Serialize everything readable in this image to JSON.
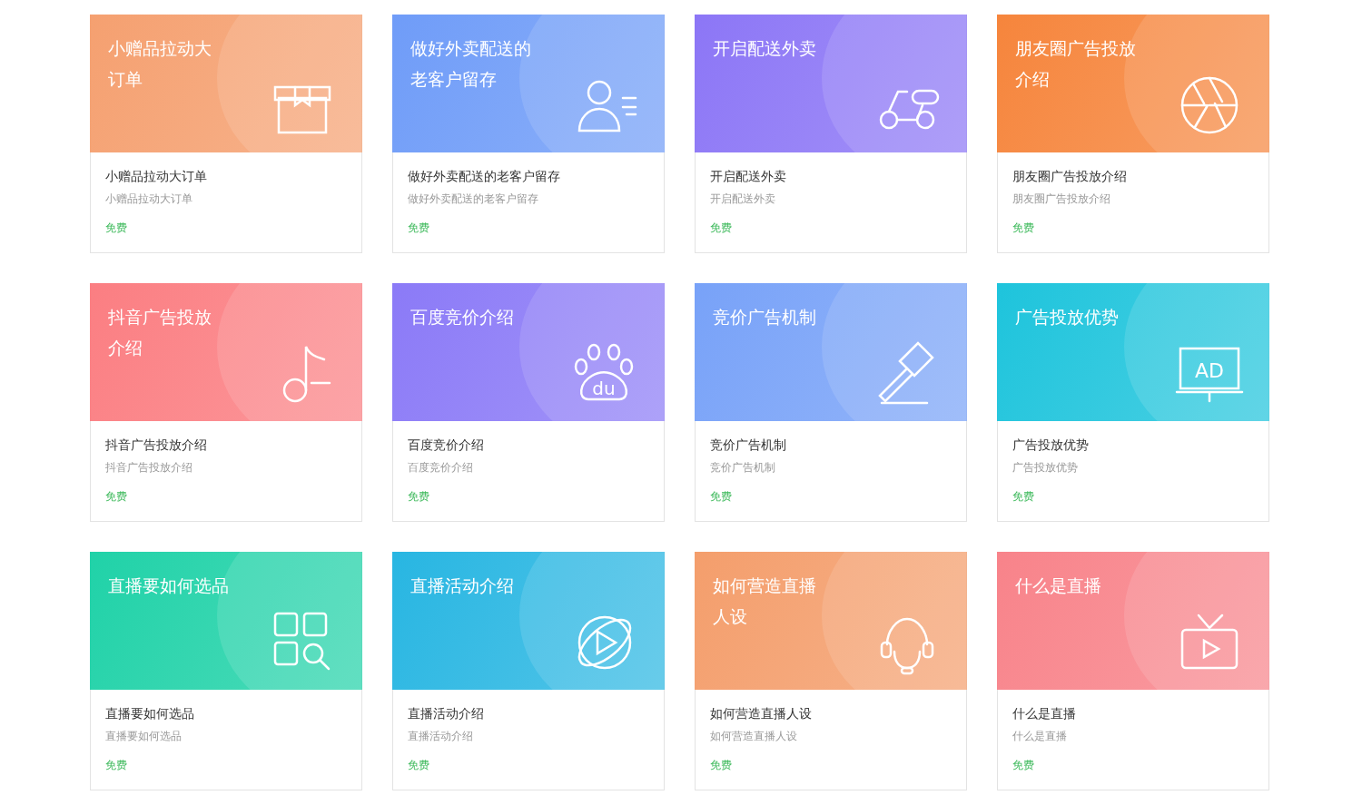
{
  "cards": [
    {
      "banner_lines": [
        "小赠品拉动大",
        "订单"
      ],
      "title": "小赠品拉动大订单",
      "subtitle": "小赠品拉动大订单",
      "price": "免费",
      "color": "#f5a070",
      "kind": "gift"
    },
    {
      "banner_lines": [
        "做好外卖配送的",
        "老客户留存"
      ],
      "title": "做好外卖配送的老客户留存",
      "subtitle": "做好外卖配送的老客户留存",
      "price": "免费",
      "color": "#6f9cf8",
      "kind": "user"
    },
    {
      "banner_lines": [
        "开启配送外卖"
      ],
      "title": "开启配送外卖",
      "subtitle": "开启配送外卖",
      "price": "免费",
      "color": "#8c76f6",
      "kind": "scooter"
    },
    {
      "banner_lines": [
        "朋友圈广告投放",
        "介绍"
      ],
      "title": "朋友圈广告投放介绍",
      "subtitle": "朋友圈广告投放介绍",
      "price": "免费",
      "color": "#f6853c",
      "kind": "aperture"
    },
    {
      "banner_lines": [
        "抖音广告投放",
        "介绍"
      ],
      "title": "抖音广告投放介绍",
      "subtitle": "抖音广告投放介绍",
      "price": "免费",
      "color": "#fb7e82",
      "kind": "music"
    },
    {
      "banner_lines": [
        "百度竞价介绍"
      ],
      "title": "百度竞价介绍",
      "subtitle": "百度竞价介绍",
      "price": "免费",
      "color": "#8b7af7",
      "kind": "paw",
      "icon_text": "du"
    },
    {
      "banner_lines": [
        "竞价广告机制"
      ],
      "title": "竞价广告机制",
      "subtitle": "竞价广告机制",
      "price": "免费",
      "color": "#78a2f8",
      "kind": "gavel"
    },
    {
      "banner_lines": [
        "广告投放优势"
      ],
      "title": "广告投放优势",
      "subtitle": "广告投放优势",
      "price": "免费",
      "color": "#1ec4dc",
      "kind": "ad",
      "icon_text": "AD"
    },
    {
      "banner_lines": [
        "直播要如何选品"
      ],
      "title": "直播要如何选品",
      "subtitle": "直播要如何选品",
      "price": "免费",
      "color": "#20d2a8",
      "kind": "grid"
    },
    {
      "banner_lines": [
        "直播活动介绍"
      ],
      "title": "直播活动介绍",
      "subtitle": "直播活动介绍",
      "price": "免费",
      "color": "#28b6e2",
      "kind": "play"
    },
    {
      "banner_lines": [
        "如何营造直播",
        "人设"
      ],
      "title": "如何营造直播人设",
      "subtitle": "如何营造直播人设",
      "price": "免费",
      "color": "#f49e6c",
      "kind": "headset"
    },
    {
      "banner_lines": [
        "什么是直播"
      ],
      "title": "什么是直播",
      "subtitle": "什么是直播",
      "price": "免费",
      "color": "#f8838a",
      "kind": "tv"
    }
  ]
}
